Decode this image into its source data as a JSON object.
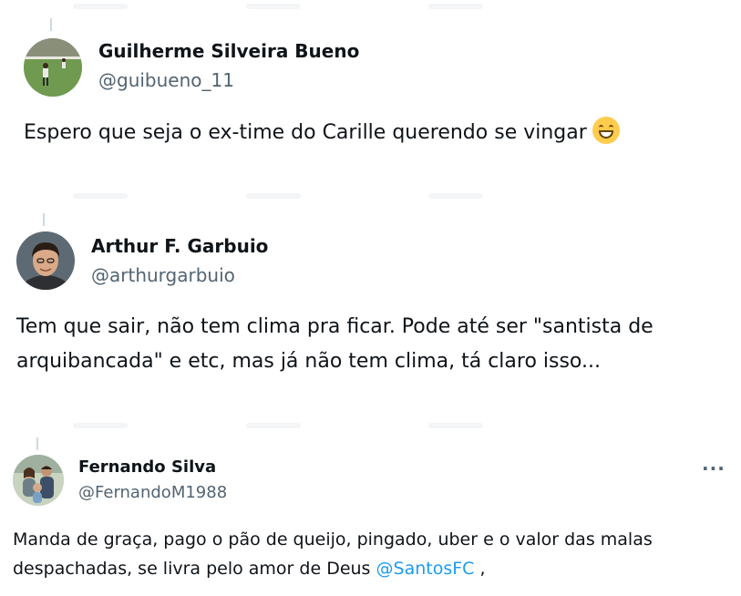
{
  "tweets": [
    {
      "name": "Guilherme Silveira Bueno",
      "handle": "@guibueno_11",
      "text": "Espero que seja o ex-time do Carille querendo se vingar",
      "emoji": "grinning-face-with-smiling-eyes"
    },
    {
      "name": "Arthur F. Garbuio",
      "handle": "@arthurgarbuio",
      "text_line1": "Tem que sair, não tem clima pra ficar. Pode até ser \"santista de",
      "text_line2": "arquibancada\" e etc, mas já não tem clima, tá claro isso..."
    },
    {
      "name": "Fernando Silva",
      "handle": "@FernandoM1988",
      "text_line1": "Manda de graça, pago o pão de queijo, pingado, uber e o valor das malas",
      "text_line2_before": "despachadas, se livra pelo amor de Deus",
      "mention": "@SantosFC",
      "text_line2_after": ",",
      "more_label": "···"
    }
  ],
  "colors": {
    "text": "#0f1419",
    "secondary": "#536471",
    "link": "#1d9bf0",
    "divider": "#cfd9de"
  }
}
